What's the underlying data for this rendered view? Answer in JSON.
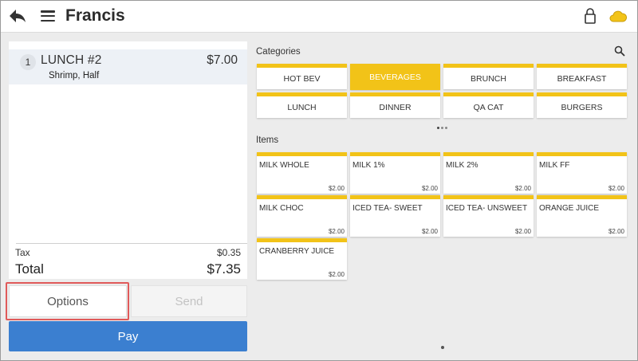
{
  "header": {
    "title": "Francis",
    "icons": {
      "back": "back-arrow-icon",
      "menu": "hamburger-menu-icon",
      "lock": "lock-icon",
      "cloud": "cloud-icon"
    },
    "cloud_color": "#f2c318"
  },
  "order": {
    "lines": [
      {
        "qty": "1",
        "name": "LUNCH #2",
        "price": "$7.00",
        "modifier": "Shrimp, Half"
      }
    ],
    "tax_label": "Tax",
    "tax_value": "$0.35",
    "total_label": "Total",
    "total_value": "$7.35"
  },
  "actions": {
    "options_label": "Options",
    "send_label": "Send",
    "pay_label": "Pay",
    "pay_color": "#3b7fd0"
  },
  "categories": {
    "label": "Categories",
    "selected": "BEVERAGES",
    "accent": "#f2c318",
    "items": [
      "HOT BEV",
      "BEVERAGES",
      "BRUNCH",
      "BREAKFAST",
      "LUNCH",
      "DINNER",
      "QA CAT",
      "BURGERS"
    ]
  },
  "items": {
    "label": "Items",
    "list": [
      {
        "name": "MILK WHOLE",
        "price": "$2.00"
      },
      {
        "name": "MILK 1%",
        "price": "$2.00"
      },
      {
        "name": "MILK 2%",
        "price": "$2.00"
      },
      {
        "name": "MILK FF",
        "price": "$2.00"
      },
      {
        "name": "MILK CHOC",
        "price": "$2.00"
      },
      {
        "name": "ICED TEA- SWEET",
        "price": "$2.00"
      },
      {
        "name": "ICED TEA- UNSWEET",
        "price": "$2.00"
      },
      {
        "name": "ORANGE JUICE",
        "price": "$2.00"
      },
      {
        "name": "CRANBERRY JUICE",
        "price": "$2.00"
      }
    ]
  }
}
